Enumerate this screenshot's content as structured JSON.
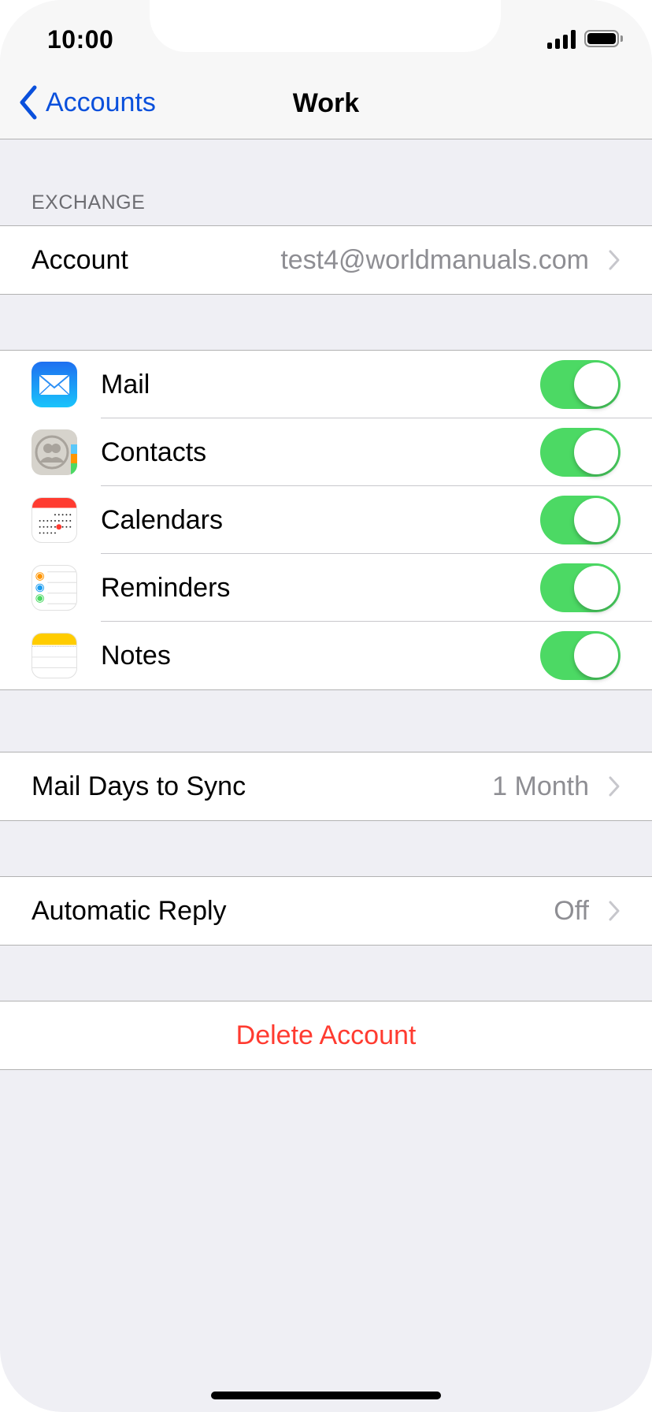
{
  "status_bar": {
    "time": "10:00",
    "signal_icon": "cellular-signal-icon",
    "battery_icon": "battery-full-icon"
  },
  "nav": {
    "back_label": "Accounts",
    "title": "Work"
  },
  "exchange_section": {
    "header": "EXCHANGE",
    "account_label": "Account",
    "account_value": "test4@worldmanuals.com"
  },
  "services": [
    {
      "label": "Mail",
      "icon": "mail-icon",
      "enabled": true
    },
    {
      "label": "Contacts",
      "icon": "contacts-icon",
      "enabled": true
    },
    {
      "label": "Calendars",
      "icon": "calendar-icon",
      "enabled": true
    },
    {
      "label": "Reminders",
      "icon": "reminders-icon",
      "enabled": true
    },
    {
      "label": "Notes",
      "icon": "notes-icon",
      "enabled": true
    }
  ],
  "sync": {
    "label": "Mail Days to Sync",
    "value": "1 Month"
  },
  "auto_reply": {
    "label": "Automatic Reply",
    "value": "Off"
  },
  "delete": {
    "label": "Delete Account"
  },
  "colors": {
    "accent": "#0a50dc",
    "toggle_on": "#4cd964",
    "destructive": "#ff3b30",
    "secondary_text": "#8e8e93",
    "background": "#efeff4"
  }
}
